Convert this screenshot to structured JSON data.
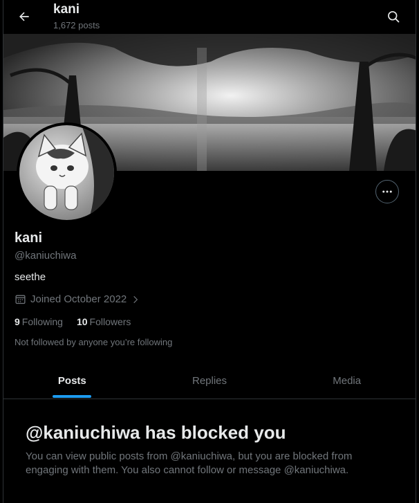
{
  "header": {
    "name": "kani",
    "post_count": "1,672 posts"
  },
  "icons": {
    "back": "arrow-left-icon",
    "search": "search-icon",
    "more": "more-horizontal-icon",
    "calendar": "calendar-icon",
    "chevron": "chevron-right-icon"
  },
  "profile": {
    "display_name": "kani",
    "handle": "@kaniuchiwa",
    "bio": "seethe",
    "joined": "Joined October 2022",
    "following_count": "9",
    "following_label": "Following",
    "followers_count": "10",
    "followers_label": "Followers",
    "not_followed_text": "Not followed by anyone you’re following"
  },
  "tabs": [
    {
      "label": "Posts",
      "active": true
    },
    {
      "label": "Replies",
      "active": false
    },
    {
      "label": "Media",
      "active": false
    }
  ],
  "blocked": {
    "title": "@kaniuchiwa has blocked you",
    "message": "You can view public posts from @kaniuchiwa, but you are blocked from engaging with them. You also cannot follow or message @kaniuchiwa."
  },
  "colors": {
    "background": "#000000",
    "text_primary": "#e7e9ea",
    "text_secondary": "#71767b",
    "accent": "#1d9bf0",
    "border": "#2f3336"
  }
}
